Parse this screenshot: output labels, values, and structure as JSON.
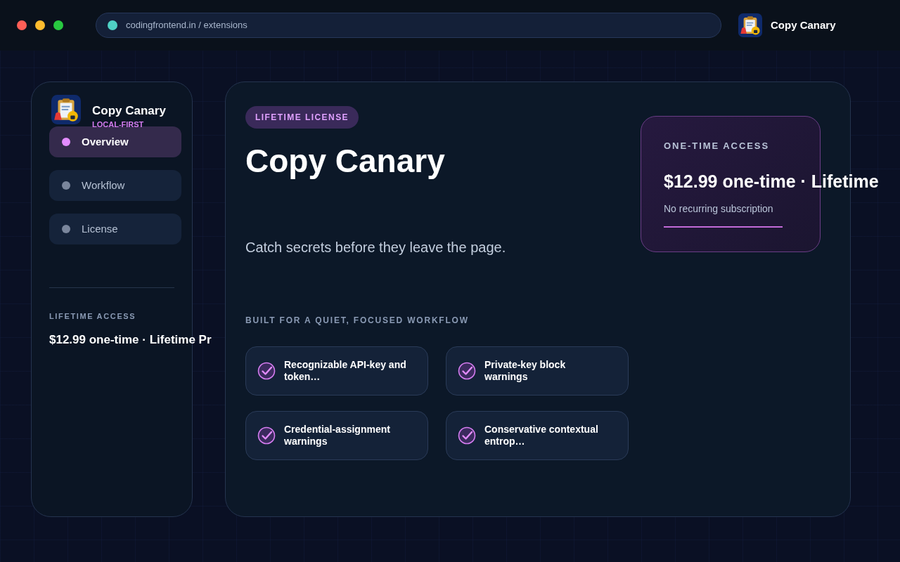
{
  "browser": {
    "url": "codingfrontend.in / extensions",
    "app_title": "Copy Canary"
  },
  "sidebar": {
    "title": "Copy Canary",
    "subtitle": "LOCAL-FIRST",
    "items": [
      {
        "label": "Overview",
        "selected": true
      },
      {
        "label": "Workflow",
        "selected": false
      },
      {
        "label": "License",
        "selected": false
      }
    ],
    "footer_label": "LIFETIME ACCESS",
    "footer_price": "$12.99 one-time · Lifetime Pr"
  },
  "main": {
    "badge": "LIFETIME LICENSE",
    "title": "Copy Canary",
    "tagline": "Catch secrets before they leave the page.",
    "section_label": "BUILT FOR A QUIET, FOCUSED WORKFLOW",
    "features": [
      {
        "text": "Recognizable API-key and token…",
        "checked": true
      },
      {
        "text": "Private-key block warnings",
        "checked": true
      },
      {
        "text": "Credential-assignment warnings",
        "checked": true
      },
      {
        "text": "Conservative contextual entrop…",
        "checked": true
      }
    ],
    "price_card": {
      "label": "ONE-TIME ACCESS",
      "price": "$12.99 one-time · Lifetime",
      "note": "No recurring subscription"
    }
  }
}
